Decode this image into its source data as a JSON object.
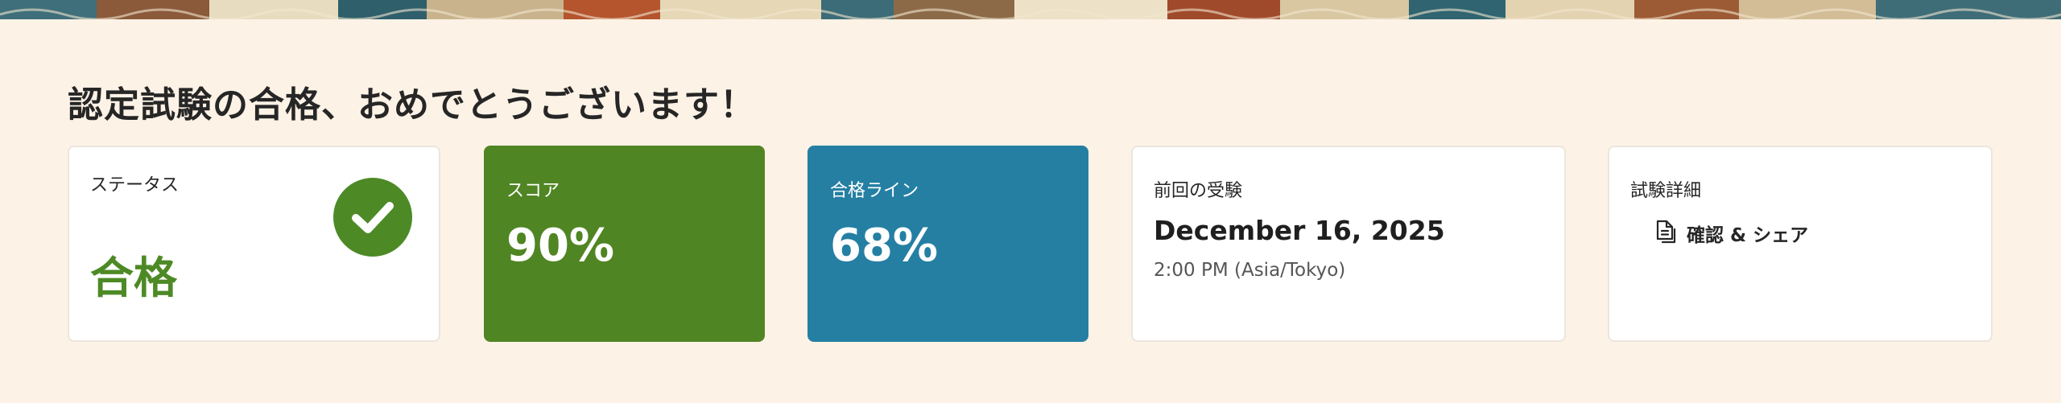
{
  "page": {
    "heading": "認定試験の合格、おめでとうございます！"
  },
  "cards": {
    "status": {
      "label": "ステータス",
      "value": "合格",
      "icon": "check-circle-icon",
      "color": "#4d8a26"
    },
    "score": {
      "label": "スコア",
      "value": "90%",
      "color": "#508523"
    },
    "passing": {
      "label": "合格ライン",
      "value": "68%",
      "color": "#257fa3"
    },
    "previous_exam": {
      "label": "前回の受験",
      "date": "December 16, 2025",
      "time": "2:00 PM (Asia/Tokyo)"
    },
    "exam_details": {
      "label": "試験詳細",
      "link_text": "確認 & シェア",
      "icon": "document-icon"
    }
  },
  "colors": {
    "background": "#fdf2e6",
    "card": "#ffffff"
  }
}
